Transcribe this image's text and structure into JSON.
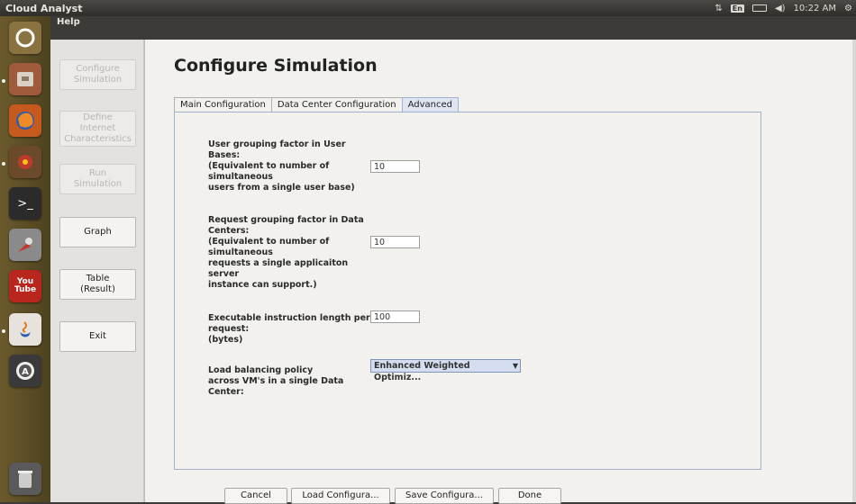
{
  "system": {
    "app_title": "Cloud Analyst",
    "keyboard": "En",
    "clock": "10:22 AM"
  },
  "menu": {
    "help": "Help"
  },
  "nav": {
    "configure": "Configure\nSimulation",
    "define": "Define\nInternet\nCharacteristics",
    "run": "Run\nSimulation",
    "graph": "Graph",
    "table": "Table\n(Result)",
    "exit": "Exit"
  },
  "page": {
    "title": "Configure Simulation",
    "tabs": [
      "Main Configuration",
      "Data Center Configuration",
      "Advanced"
    ],
    "active_tab": "Advanced"
  },
  "fields": {
    "user_grouping_label": "User grouping factor in User\nBases:\n(Equivalent to number of\nsimultaneous\nusers from a single user base)",
    "user_grouping_value": "10",
    "request_grouping_label": "Request grouping factor in Data\nCenters:\n(Equivalent to number of\nsimultaneous\nrequests a single applicaiton\nserver\ninstance can support.)",
    "request_grouping_value": "10",
    "instruction_length_label": "Executable instruction length per\nrequest:\n(bytes)",
    "instruction_length_value": "100",
    "load_balancing_label": "Load balancing policy\nacross VM's in a single Data\nCenter:",
    "load_balancing_value": "Enhanced Weighted Optimiz..."
  },
  "buttons": {
    "cancel": "Cancel",
    "load": "Load Configura...",
    "save": "Save Configura...",
    "done": "Done"
  },
  "colors": {
    "launcher": "#5c4e26",
    "active_tab": "#dfe6f2",
    "panel_border": "#9fb1cc"
  }
}
